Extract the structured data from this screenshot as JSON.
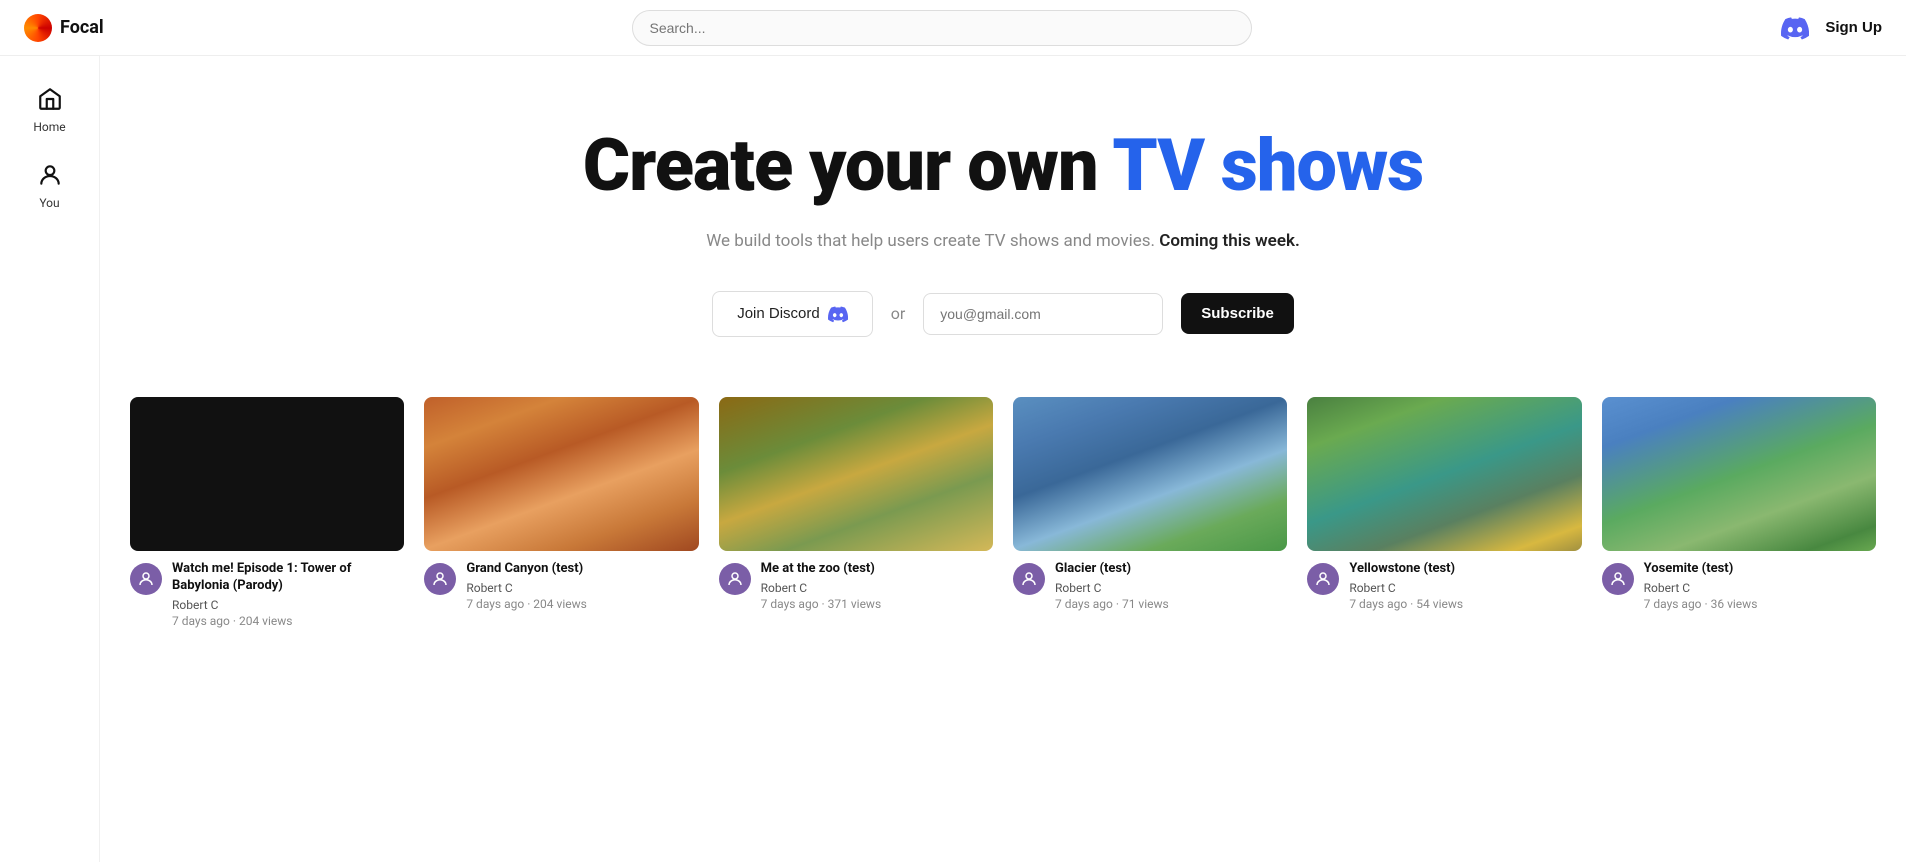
{
  "header": {
    "logo_text": "Focal",
    "search_placeholder": "Search...",
    "discord_label": "Discord",
    "sign_up_label": "Sign Up"
  },
  "sidebar": {
    "items": [
      {
        "id": "home",
        "label": "Home",
        "icon": "home-icon"
      },
      {
        "id": "you",
        "label": "You",
        "icon": "user-icon"
      }
    ]
  },
  "hero": {
    "title_part1": "Create your own ",
    "title_part2": "TV shows",
    "subtitle_part1": "We build tools that help users create TV shows and movies. ",
    "subtitle_emphasis": "Coming this week.",
    "join_discord_label": "Join Discord",
    "or_label": "or",
    "email_placeholder": "you@gmail.com",
    "subscribe_label": "Subscribe"
  },
  "cards": [
    {
      "id": "card-1",
      "title": "Watch me! Episode 1: Tower of Babylonia (Parody)",
      "author": "Robert C",
      "stats": "7 days ago · 204 views",
      "thumb_class": "thumb-black"
    },
    {
      "id": "card-2",
      "title": "Grand Canyon (test)",
      "author": "Robert C",
      "stats": "7 days ago · 204 views",
      "thumb_class": "thumb-grand-canyon"
    },
    {
      "id": "card-3",
      "title": "Me at the zoo (test)",
      "author": "Robert C",
      "stats": "7 days ago · 371 views",
      "thumb_class": "thumb-zoo"
    },
    {
      "id": "card-4",
      "title": "Glacier (test)",
      "author": "Robert C",
      "stats": "7 days ago · 71 views",
      "thumb_class": "thumb-glacier"
    },
    {
      "id": "card-5",
      "title": "Yellowstone (test)",
      "author": "Robert C",
      "stats": "7 days ago · 54 views",
      "thumb_class": "thumb-yellowstone"
    },
    {
      "id": "card-6",
      "title": "Yosemite (test)",
      "author": "Robert C",
      "stats": "7 days ago · 36 views",
      "thumb_class": "thumb-yosemite"
    }
  ],
  "colors": {
    "accent_blue": "#2563eb",
    "dark": "#111111",
    "discord_purple": "#5865F2"
  }
}
